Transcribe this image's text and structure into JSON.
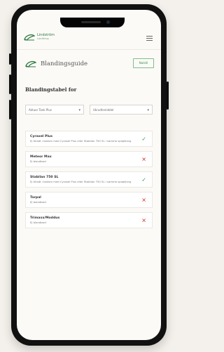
{
  "app": {
    "logo_name": "Lindström",
    "logo_sub": "Landbrug"
  },
  "guide": {
    "title": "Blandingsguide",
    "reset_button": "Nulstil",
    "table_title": "Blandingstabel for"
  },
  "filters": {
    "product": "Aktuar Tank Plus",
    "category": "Ukrudtsmiddel"
  },
  "items": [
    {
      "name": "Cyraxel Plus",
      "desc": "Ej tilladt i tanken med Cyraxel Plus eller Stabilan 750 SL i samme sprøjtning",
      "status": "ok"
    },
    {
      "name": "Meteor Max",
      "desc": "Ej blandbart",
      "status": "no"
    },
    {
      "name": "Stabilan 750 SL",
      "desc": "Ej tilladt i tanken med Cyraxel Plus eller Stabilan 750 SL i samme sprøjtning",
      "status": "ok"
    },
    {
      "name": "Tarpal",
      "desc": "Ej blandbart",
      "status": "no"
    },
    {
      "name": "Trimaxx/Moddus",
      "desc": "Ej blandbart",
      "status": "no"
    }
  ],
  "icons": {
    "ok": "✓",
    "no": "✕",
    "chevron": "▾"
  },
  "colors": {
    "brand_green": "#2f7a3e",
    "ok_green": "#3aa34a",
    "error_red": "#d23a2d"
  }
}
